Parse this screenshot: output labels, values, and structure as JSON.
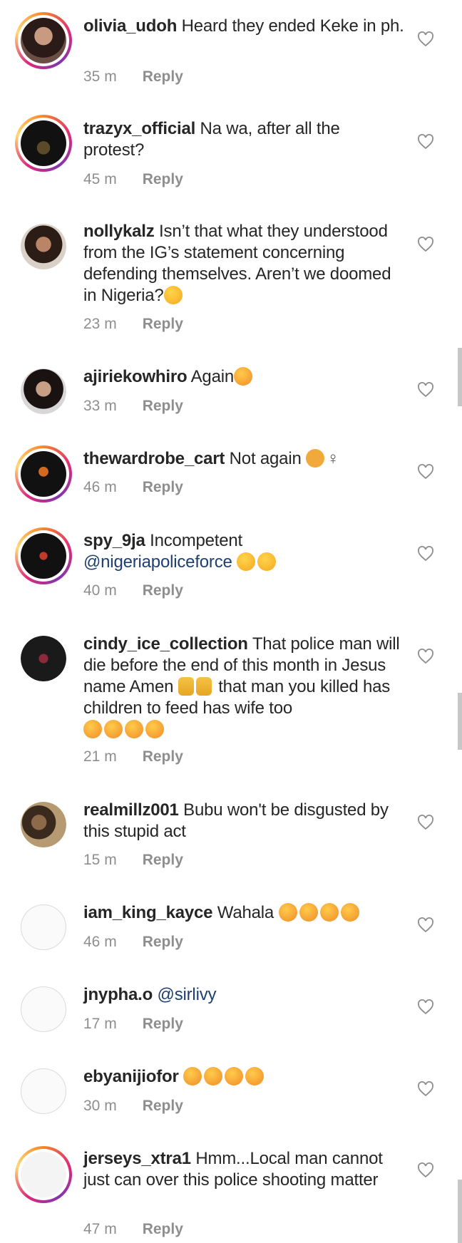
{
  "comments": [
    {
      "user": "olivia_udoh",
      "text": "Heard they ended Keke in ph.",
      "time": "35 m",
      "reply": "Reply"
    },
    {
      "user": "trazyx_official",
      "text": "Na wa, after all the protest?",
      "time": "45 m",
      "reply": "Reply"
    },
    {
      "user": "nollykalz",
      "text": "Isn’t that what they understood from the IG’s statement concerning defending themselves. Aren’t we doomed in Nigeria?",
      "time": "23 m",
      "reply": "Reply"
    },
    {
      "user": "ajiriekowhiro",
      "text": "Again",
      "time": "33 m",
      "reply": "Reply"
    },
    {
      "user": "thewardrobe_cart",
      "text": "Not again",
      "time": "46 m",
      "reply": "Reply"
    },
    {
      "user": "spy_9ja",
      "text": "Incompetent",
      "mention": "@nigeriapoliceforce",
      "time": "40 m",
      "reply": "Reply"
    },
    {
      "user": "cindy_ice_collection",
      "text": "That police man will die before the end of this month in Jesus name Amen",
      "text2": "that man you killed has children to feed has wife too",
      "time": "21 m",
      "reply": "Reply"
    },
    {
      "user": "realmillz001",
      "text": "Bubu won't be disgusted by this stupid act",
      "time": "15 m",
      "reply": "Reply"
    },
    {
      "user": "iam_king_kayce",
      "text": "Wahala",
      "time": "46 m",
      "reply": "Reply"
    },
    {
      "user": "jnypha.o",
      "text": "",
      "mention": "@sirlivy",
      "time": "17 m",
      "reply": "Reply"
    },
    {
      "user": "ebyanijiofor",
      "text": "",
      "time": "30 m",
      "reply": "Reply"
    },
    {
      "user": "jerseys_xtra1",
      "text": "Hmm...Local man cannot just can over this police shooting matter",
      "time": "47 m",
      "reply": "Reply"
    }
  ],
  "icons": {
    "like": "heart-outline-icon",
    "emoji_sad": "frowning-face-emoji",
    "emoji_angry": "steam-face-emoji",
    "emoji_facepalm": "woman-facepalming-emoji",
    "emoji_pray": "praying-hands-emoji"
  },
  "colors": {
    "username": "#262626",
    "meta": "#8e8e8e",
    "mention": "#1d3f72",
    "ring": "#dd2a7b"
  }
}
